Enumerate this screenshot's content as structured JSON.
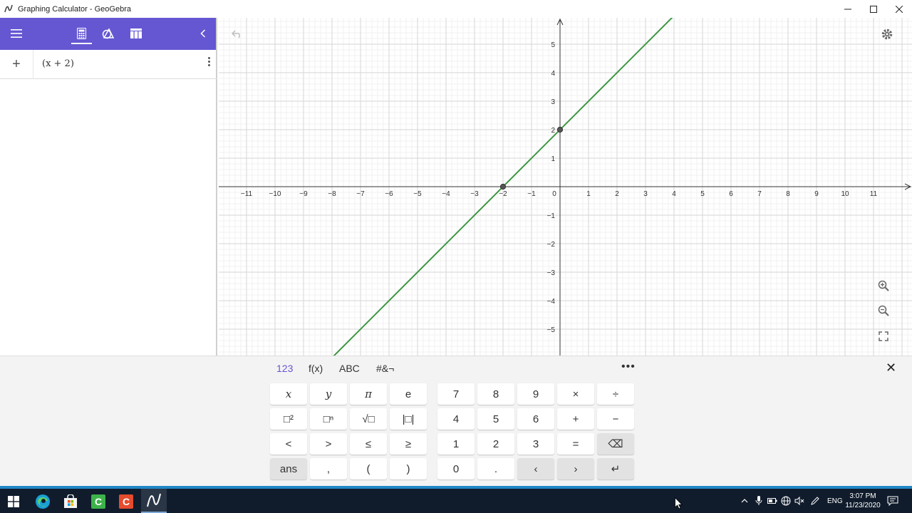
{
  "window": {
    "title": "Graphing Calculator - GeoGebra",
    "controls": [
      "minimize",
      "maximize",
      "close"
    ]
  },
  "toolbar": {
    "tabs": [
      "menu",
      "algebra",
      "tools",
      "table",
      "collapse"
    ],
    "active_tab": "algebra"
  },
  "algebra": {
    "input_value": "(x + 2)",
    "add_label": "+"
  },
  "graph": {
    "function": "y = x + 2",
    "line_color": "#3d9642",
    "points": [
      {
        "x": -2,
        "y": 0
      },
      {
        "x": 0,
        "y": 2
      }
    ],
    "x_ticks": [
      "−11",
      "−10",
      "−9",
      "−8",
      "−7",
      "−6",
      "−5",
      "−4",
      "−3",
      "−2",
      "−1",
      "0",
      "1",
      "2",
      "3",
      "4",
      "5",
      "6",
      "7",
      "8",
      "9",
      "10",
      "11"
    ],
    "y_ticks": [
      "5",
      "4",
      "3",
      "2",
      "1",
      "−1",
      "−2",
      "−3",
      "−4",
      "−5"
    ],
    "x_range": [
      -12,
      12
    ],
    "y_range": [
      -6,
      6
    ]
  },
  "keyboard": {
    "tabs": [
      {
        "label": "123",
        "active": true
      },
      {
        "label": "f(x)",
        "active": false
      },
      {
        "label": "ABC",
        "active": false
      },
      {
        "label": "#&¬",
        "active": false
      }
    ],
    "more": "•••",
    "close": "✕",
    "left_keys": [
      [
        "x",
        "y",
        "π",
        "e"
      ],
      [
        "□²",
        "□ⁿ",
        "√□",
        "|□|"
      ],
      [
        "<",
        ">",
        "≤",
        "≥"
      ],
      [
        "ans",
        ",",
        "(",
        ")"
      ]
    ],
    "right_keys": [
      [
        "7",
        "8",
        "9",
        "×",
        "÷"
      ],
      [
        "4",
        "5",
        "6",
        "+",
        "−"
      ],
      [
        "1",
        "2",
        "3",
        "=",
        "⌫"
      ],
      [
        "0",
        ".",
        "‹",
        "›",
        "↵"
      ]
    ]
  },
  "taskbar": {
    "apps": [
      "start",
      "edge",
      "store",
      "camtasia-green",
      "camtasia-red",
      "geogebra"
    ],
    "tray": {
      "language": "ENG",
      "time": "3:07 PM",
      "date": "11/23/2020"
    }
  },
  "colors": {
    "accent": "#6557d2",
    "taskbar": "#101c2c",
    "line": "#3d9642"
  }
}
